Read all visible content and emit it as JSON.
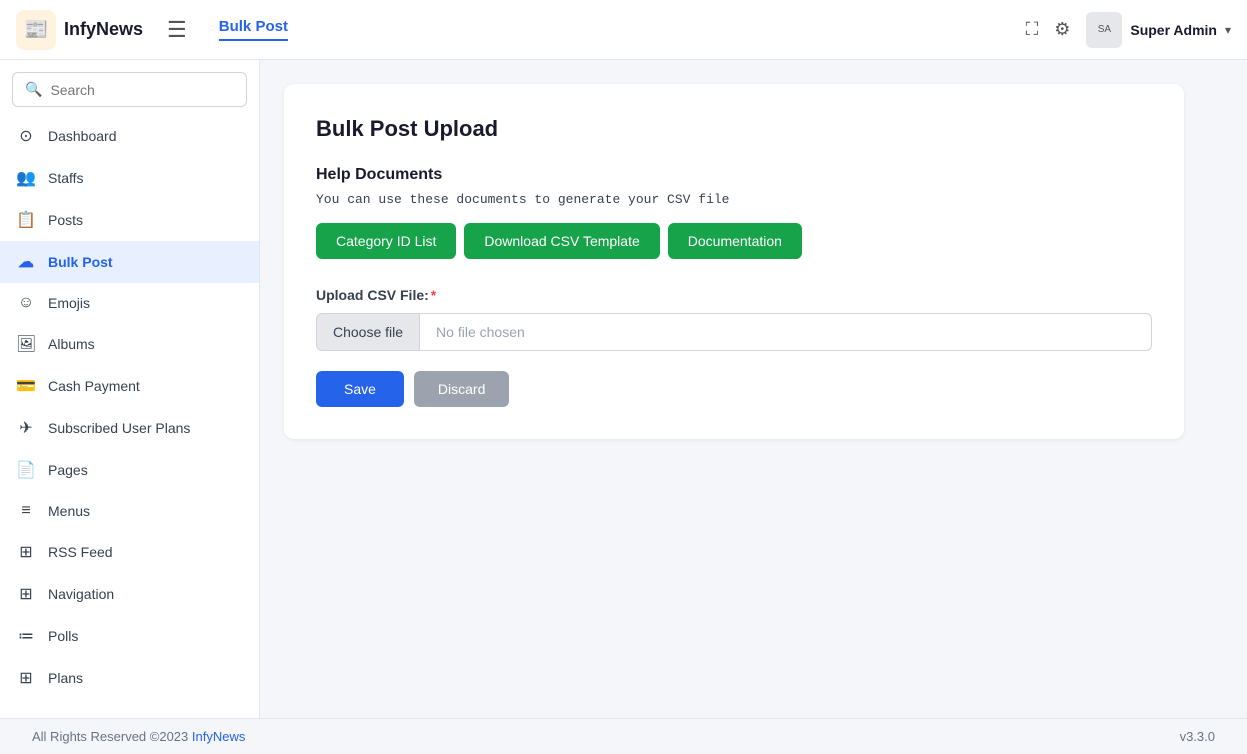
{
  "header": {
    "logo_emoji": "📰",
    "app_name": "InfyNews",
    "hamburger_icon": "☰",
    "active_tab": "Bulk Post",
    "expand_icon": "⛶",
    "gear_icon": "⚙",
    "user_name": "Super Admin",
    "chevron_icon": "▾",
    "user_avatar_text": "SA"
  },
  "sidebar": {
    "search_placeholder": "Search",
    "items": [
      {
        "id": "dashboard",
        "label": "Dashboard",
        "icon": "○"
      },
      {
        "id": "staffs",
        "label": "Staffs",
        "icon": "👥"
      },
      {
        "id": "posts",
        "label": "Posts",
        "icon": "📋"
      },
      {
        "id": "bulk-post",
        "label": "Bulk Post",
        "icon": "☁"
      },
      {
        "id": "emojis",
        "label": "Emojis",
        "icon": "☺"
      },
      {
        "id": "albums",
        "label": "Albums",
        "icon": "🖼"
      },
      {
        "id": "cash-payment",
        "label": "Cash Payment",
        "icon": "💳"
      },
      {
        "id": "subscribed-user-plans",
        "label": "Subscribed User Plans",
        "icon": "✈"
      },
      {
        "id": "pages",
        "label": "Pages",
        "icon": "📄"
      },
      {
        "id": "menus",
        "label": "Menus",
        "icon": "≡"
      },
      {
        "id": "rss-feed",
        "label": "RSS Feed",
        "icon": "⊞"
      },
      {
        "id": "navigation",
        "label": "Navigation",
        "icon": "⊞"
      },
      {
        "id": "polls",
        "label": "Polls",
        "icon": "≔"
      },
      {
        "id": "plans",
        "label": "Plans",
        "icon": "⊞"
      }
    ]
  },
  "main": {
    "card_title": "Bulk Post Upload",
    "help_section_title": "Help Documents",
    "help_text": "You can use these documents to generate your CSV file",
    "btn_category": "Category ID List",
    "btn_download": "Download CSV Template",
    "btn_documentation": "Documentation",
    "upload_label": "Upload CSV File:",
    "choose_file_btn": "Choose file",
    "no_file_chosen": "No file chosen",
    "save_btn": "Save",
    "discard_btn": "Discard"
  },
  "footer": {
    "copyright": "All Rights Reserved ©2023",
    "brand_link": "InfyNews",
    "version": "v3.3.0"
  }
}
